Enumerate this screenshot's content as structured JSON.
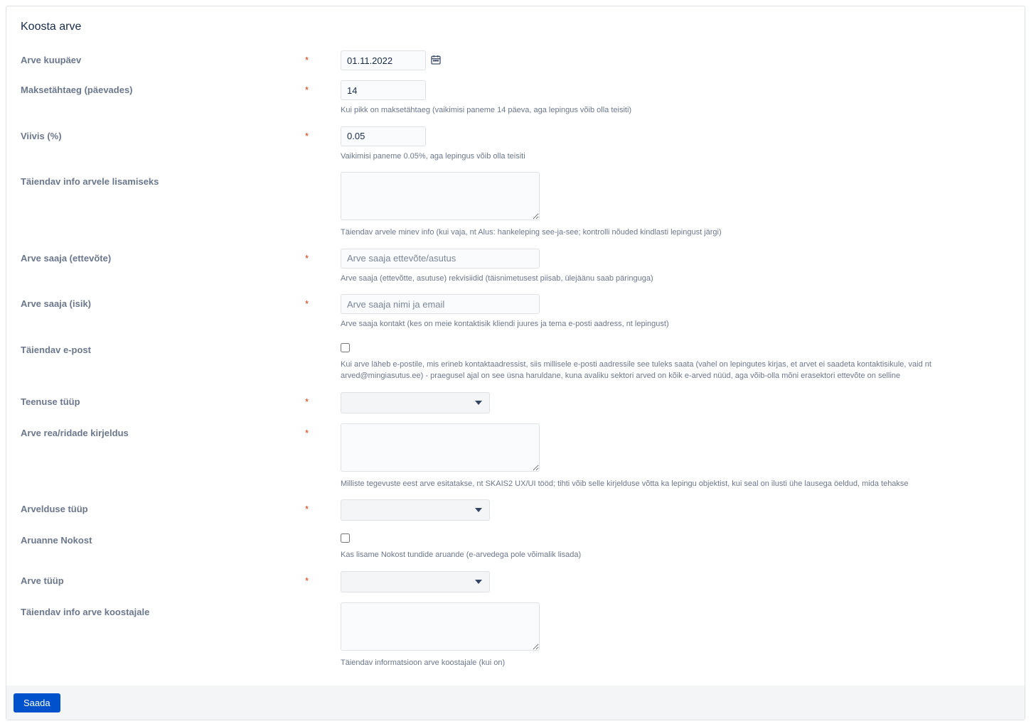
{
  "title": "Koosta arve",
  "fields": {
    "date": {
      "label": "Arve kuupäev",
      "value": "01.11.2022"
    },
    "payment_due": {
      "label": "Maksetähtaeg (päevades)",
      "value": "14",
      "help": "Kui pikk on maksetähtaeg (vaikimisi paneme 14 päeva, aga lepingus võib olla teisiti)"
    },
    "penalty": {
      "label": "Viivis (%)",
      "value": "0.05",
      "help": "Vaikimisi paneme 0.05%, aga lepingus võib olla teisiti"
    },
    "extra_info_invoice": {
      "label": "Täiendav info arvele lisamiseks",
      "help": "Täiendav arvele minev info (kui vaja, nt Alus: hankeleping see-ja-see; kontrolli nõuded kindlasti lepingust järgi)"
    },
    "recipient_company": {
      "label": "Arve saaja (ettevõte)",
      "placeholder": "Arve saaja ettevõte/asutus",
      "help": "Arve saaja (ettevõtte, asutuse) rekvisiidid (täisnimetusest piisab, ülejäänu saab päringuga)"
    },
    "recipient_person": {
      "label": "Arve saaja (isik)",
      "placeholder": "Arve saaja nimi ja email",
      "help": "Arve saaja kontakt (kes on meie kontaktisik kliendi juures ja tema e-posti aadress, nt lepingust)"
    },
    "extra_email": {
      "label": "Täiendav e-post",
      "help": "Kui arve läheb e-postile, mis erineb kontaktaadressist, siis millisele e-posti aadressile see tuleks saata (vahel on lepingutes kirjas, et arvet ei saadeta kontaktisikule, vaid nt arved@mingiasutus.ee) - praegusel ajal on see üsna haruldane, kuna avaliku sektori arved on kõik e-arved nüüd, aga võib-olla mõni erasektori ettevõte on selline"
    },
    "service_type": {
      "label": "Teenuse tüüp"
    },
    "line_description": {
      "label": "Arve rea/ridade kirjeldus",
      "help": "Milliste tegevuste eest arve esitatakse, nt SKAIS2 UX/UI tööd; tihti võib selle kirjelduse võtta ka lepingu objektist, kui seal on ilusti ühe lausega öeldud, mida tehakse"
    },
    "billing_type": {
      "label": "Arvelduse tüüp"
    },
    "noko_report": {
      "label": "Aruanne Nokost",
      "help": "Kas lisame Nokost tundide aruande (e-arvedega pole võimalik lisada)"
    },
    "invoice_type": {
      "label": "Arve tüüp"
    },
    "extra_info_creator": {
      "label": "Täiendav info arve koostajale",
      "help": "Täiendav informatsioon arve koostajale (kui on)"
    }
  },
  "submit_label": "Saada"
}
